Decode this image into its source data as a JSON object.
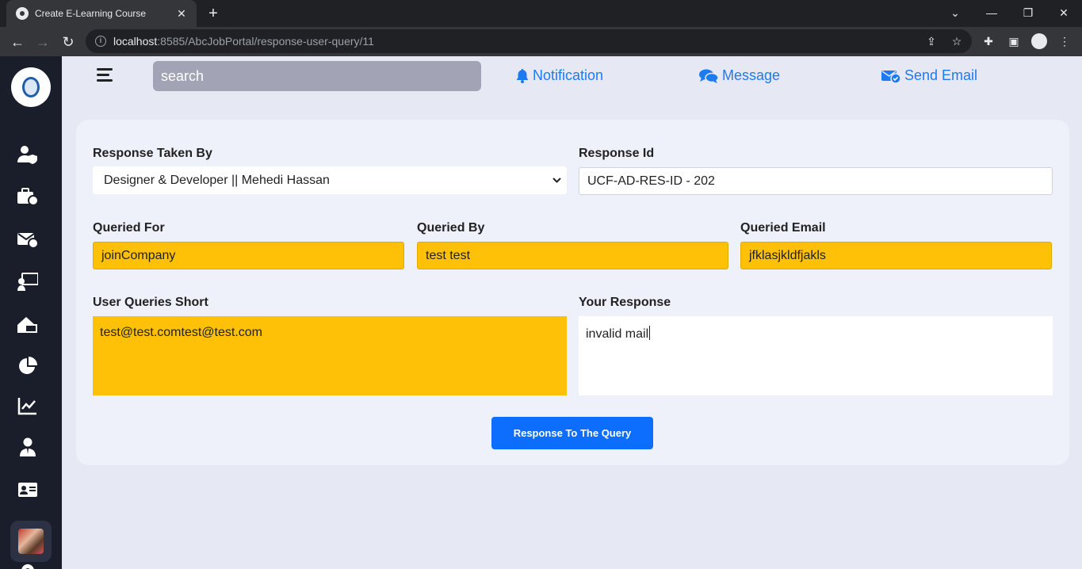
{
  "browser": {
    "tab_title": "Create E-Learning Course",
    "url_host": "localhost",
    "url_rest": ":8585/AbcJobPortal/response-user-query/11"
  },
  "header": {
    "search_placeholder": "search",
    "notification": "Notification",
    "message": "Message",
    "send_email": "Send Email"
  },
  "form": {
    "response_taken_by": {
      "label": "Response Taken By",
      "value": "Designer & Developer || Mehedi Hassan"
    },
    "response_id": {
      "label": "Response Id",
      "value": "UCF-AD-RES-ID - 202"
    },
    "queried_for": {
      "label": "Queried For",
      "value": "joinCompany"
    },
    "queried_by": {
      "label": "Queried By",
      "value": "test test"
    },
    "queried_email": {
      "label": "Queried Email",
      "value": "jfklasjkldfjakls"
    },
    "user_queries_short": {
      "label": "User Queries Short",
      "value": "test@test.comtest@test.com"
    },
    "your_response": {
      "label": "Your Response",
      "value": "invalid mail"
    },
    "submit_label": "Response To The Query"
  },
  "sidebar_icons": [
    "user-shield-icon",
    "briefcase-clock-icon",
    "envelope-check-icon",
    "chalkboard-user-icon",
    "house-laptop-icon",
    "pie-chart-icon",
    "line-chart-icon",
    "user-tie-icon",
    "id-card-icon",
    "gear-icon"
  ],
  "colors": {
    "accent": "#0d6efd",
    "highlight": "#ffc107",
    "sidebar": "#1a1e2b",
    "link": "#1d7bf0"
  }
}
